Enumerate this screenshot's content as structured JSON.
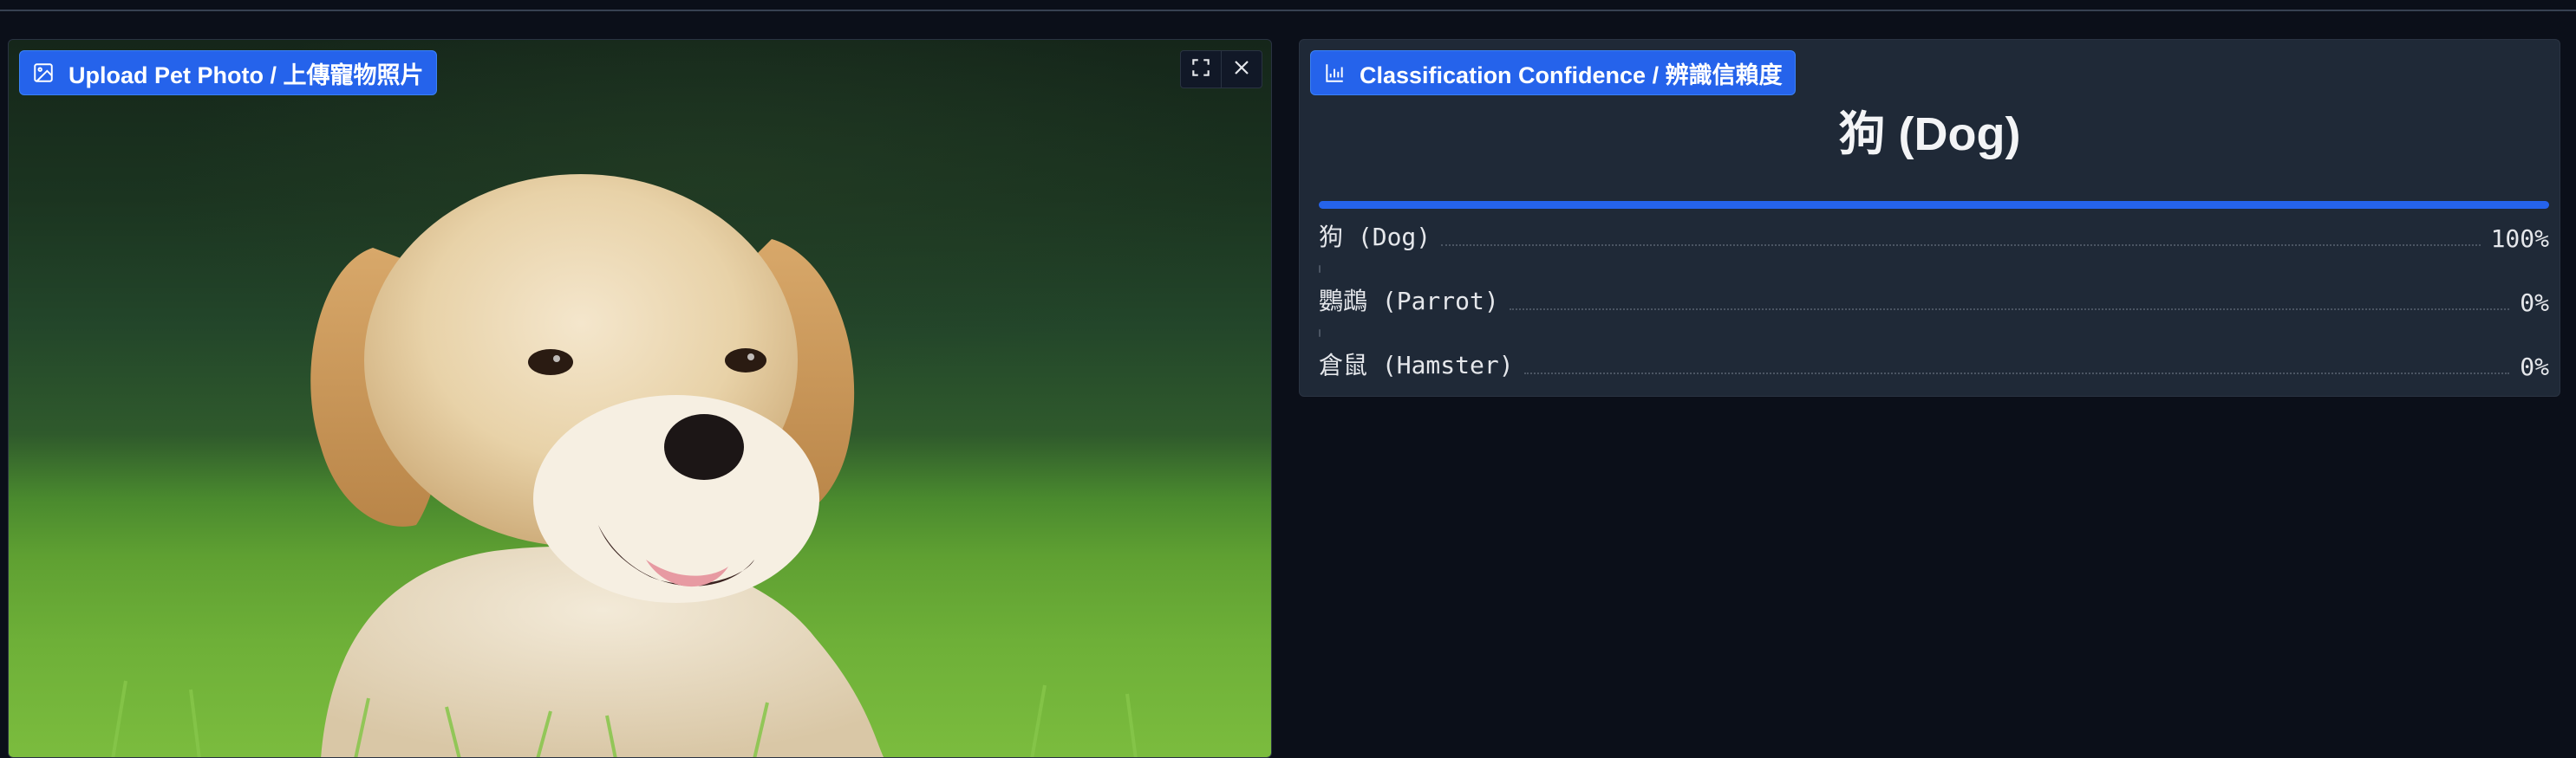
{
  "image_panel": {
    "label": "Upload Pet Photo / 上傳寵物照片",
    "label_icon": "image-icon",
    "controls": [
      {
        "name": "fullscreen",
        "icon": "fullscreen-icon"
      },
      {
        "name": "clear",
        "icon": "close-icon"
      }
    ]
  },
  "result_panel": {
    "label": "Classification Confidence / 辨識信賴度",
    "label_icon": "bar-chart-icon",
    "top_prediction": "狗 (Dog)",
    "confidences": [
      {
        "label": "狗 (Dog)",
        "value_text": "100%",
        "value": 1.0
      },
      {
        "label": "鸚鵡 (Parrot)",
        "value_text": "0%",
        "value": 0.0
      },
      {
        "label": "倉鼠 (Hamster)",
        "value_text": "0%",
        "value": 0.0
      }
    ]
  },
  "colors": {
    "background": "#0b0f19",
    "panel": "#1f2937",
    "accent": "#2563eb",
    "text": "#e5e7eb"
  }
}
